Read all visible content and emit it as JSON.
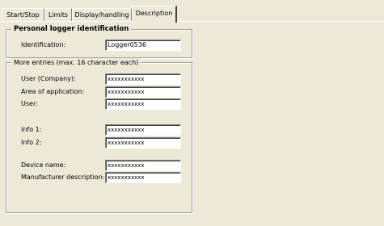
{
  "tabs": [
    {
      "label": "Start/Stop"
    },
    {
      "label": "Limits"
    },
    {
      "label": "Display/handling"
    },
    {
      "label": "Description"
    }
  ],
  "personal_group": {
    "title": "Personal logger identification",
    "identification_label": "Identification:",
    "identification_value": "Logger0536"
  },
  "more_group": {
    "title": "More entries  (max. 16 character each)",
    "user_company_label": "User (Company):",
    "user_company_value": "xxxxxxxxxxx",
    "area_label": "Area of application:",
    "area_value": "xxxxxxxxxxx",
    "user_label": "User:",
    "user_value": "xxxxxxxxxxx",
    "info1_label": "Info 1:",
    "info1_value": "xxxxxxxxxxx",
    "info2_label": "Info 2:",
    "info2_value": "xxxxxxxxxxx",
    "device_label": "Device name:",
    "device_value": "xxxxxxxxxxx",
    "manufacturer_label": "Manufacturer description:",
    "manufacturer_value": "xxxxxxxxxxx"
  }
}
